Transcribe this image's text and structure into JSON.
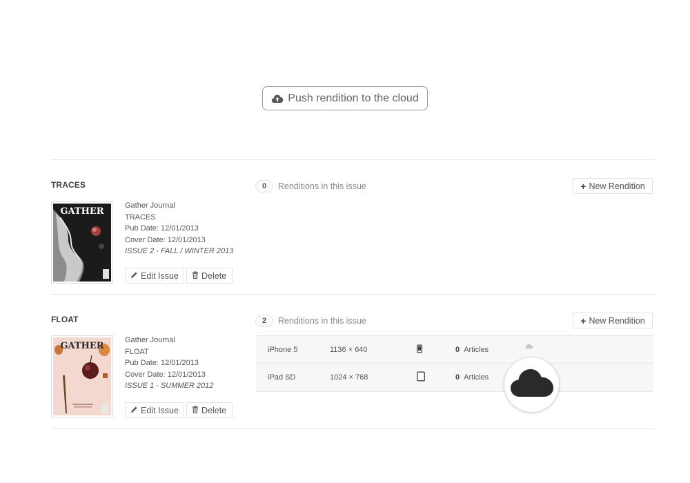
{
  "push_button": {
    "label": "Push rendition to the cloud",
    "icon": "cloud-upload-icon"
  },
  "issues": [
    {
      "name": "TRACES",
      "cover_masthead": "GATHER",
      "meta": {
        "publication": "Gather Journal",
        "title": "TRACES",
        "pub_date": "Pub Date: 12/01/2013",
        "cover_date": "Cover Date: 12/01/2013",
        "issue_label": "ISSUE 2 - FALL / WINTER 2013"
      },
      "edit_label": "Edit Issue",
      "delete_label": "Delete",
      "renditions_count": "0",
      "renditions_label": "Renditions in this issue",
      "new_rendition_label": "New Rendition",
      "renditions": []
    },
    {
      "name": "FLOAT",
      "cover_masthead": "GATHER",
      "meta": {
        "publication": "Gather Journal",
        "title": "FLOAT",
        "pub_date": "Pub Date: 12/01/2013",
        "cover_date": "Cover Date: 12/01/2013",
        "issue_label": "ISSUE 1 - SUMMER 2012"
      },
      "edit_label": "Edit Issue",
      "delete_label": "Delete",
      "renditions_count": "2",
      "renditions_label": "Renditions in this issue",
      "new_rendition_label": "New Rendition",
      "renditions": [
        {
          "device": "iPhone 5",
          "resolution": "1136 × 640",
          "device_icon": "phone-icon",
          "articles_count": "0",
          "articles_label": "Articles",
          "status_icon": "cloud-icon"
        },
        {
          "device": "iPad SD",
          "resolution": "1024 × 768",
          "device_icon": "tablet-icon",
          "articles_count": "0",
          "articles_label": "Articles",
          "status_icon": "cloud-icon"
        }
      ]
    }
  ],
  "colors": {
    "cloud_dark": "#2a2a2a",
    "cloud_light": "#c8c8c8"
  }
}
